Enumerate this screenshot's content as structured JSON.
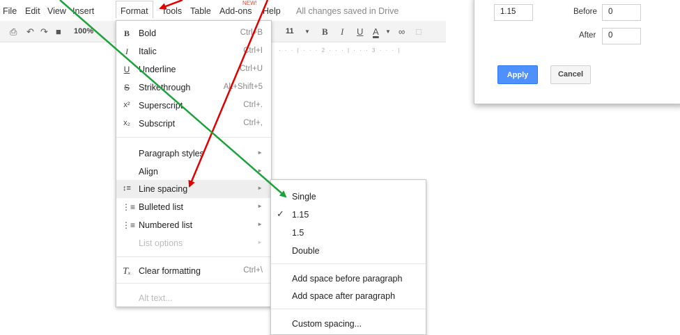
{
  "menubar": {
    "items": [
      "File",
      "Edit",
      "View",
      "Insert",
      "Format",
      "Tools",
      "Table",
      "Add-ons",
      "Help"
    ],
    "new_badge": "NEW!",
    "status": "All changes saved in Drive"
  },
  "toolbar": {
    "zoom": "100%",
    "font_size": "11",
    "ruler_mark_2": "2",
    "ruler_mark_3": "3"
  },
  "format_menu": {
    "items": [
      {
        "icon": "B",
        "label": "Bold",
        "shortcut": "Ctrl+B"
      },
      {
        "icon": "I",
        "label": "Italic",
        "shortcut": "Ctrl+I"
      },
      {
        "icon": "U",
        "label": "Underline",
        "shortcut": "Ctrl+U"
      },
      {
        "icon": "S",
        "label": "Strikethrough",
        "shortcut": "Alt+Shift+5"
      },
      {
        "icon": "x²",
        "label": "Superscript",
        "shortcut": "Ctrl+."
      },
      {
        "icon": "x₂",
        "label": "Subscript",
        "shortcut": "Ctrl+,"
      },
      {
        "label": "Paragraph styles"
      },
      {
        "label": "Align"
      },
      {
        "label": "Line spacing"
      },
      {
        "label": "Bulleted list"
      },
      {
        "label": "Numbered list"
      },
      {
        "label": "List options"
      },
      {
        "label": "Clear formatting",
        "shortcut": "Ctrl+\\"
      },
      {
        "label": "Alt text..."
      }
    ]
  },
  "line_spacing_menu": {
    "items": [
      "Single",
      "1.15",
      "1.5",
      "Double",
      "Add space before paragraph",
      "Add space after paragraph",
      "Custom spacing..."
    ]
  },
  "dialog": {
    "line_spacing_value": "1.15",
    "before_label": "Before",
    "before_value": "0",
    "after_label": "After",
    "after_value": "0",
    "apply_label": "Apply",
    "cancel_label": "Cancel"
  },
  "colors": {
    "apply_button": "#4d90fe",
    "arrow_red": "#e00000",
    "arrow_green": "#1aa33a",
    "new_badge": "#dd4b39"
  }
}
